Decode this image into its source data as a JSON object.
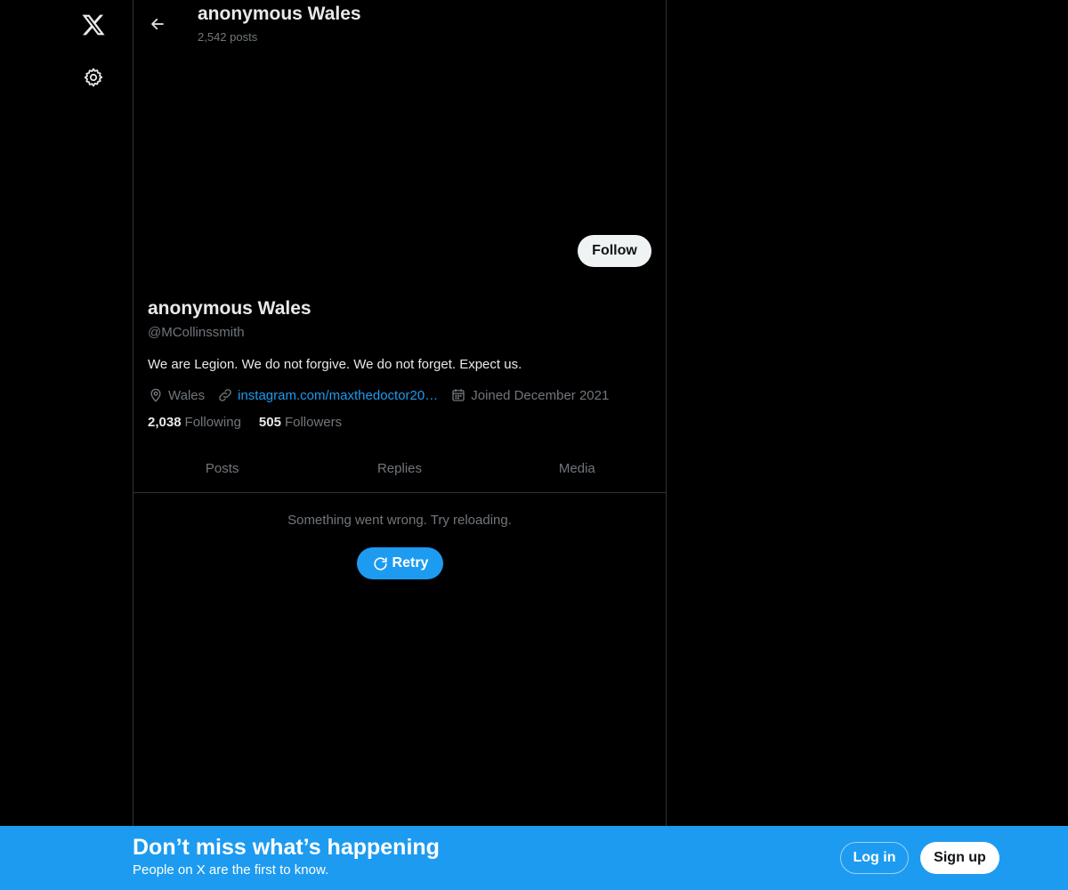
{
  "nav": {
    "logo_icon": "x-logo-icon",
    "settings_icon": "gear-icon"
  },
  "header": {
    "title": "anonymous Wales",
    "post_count": "2,542 posts"
  },
  "profile": {
    "follow_label": "Follow",
    "name": "anonymous Wales",
    "handle": "@MCollinssmith",
    "bio": "We are Legion. We do not forgive. We do not forget. Expect us.",
    "location": "Wales",
    "website": "instagram.com/maxthedoctor20…",
    "joined": "Joined December 2021",
    "following_count": "2,038",
    "following_label": "Following",
    "followers_count": "505",
    "followers_label": "Followers"
  },
  "tabs": [
    {
      "label": "Posts"
    },
    {
      "label": "Replies"
    },
    {
      "label": "Media"
    }
  ],
  "feed": {
    "error_message": "Something went wrong. Try reloading.",
    "retry_label": "Retry"
  },
  "banner": {
    "title": "Don’t miss what’s happening",
    "subtitle": "People on X are the first to know.",
    "login_label": "Log in",
    "signup_label": "Sign up"
  },
  "colors": {
    "background": "#000000",
    "accent": "#1d9bf0",
    "text_primary": "#e7e9ea",
    "text_secondary": "#71767b",
    "border": "#2f3336"
  }
}
